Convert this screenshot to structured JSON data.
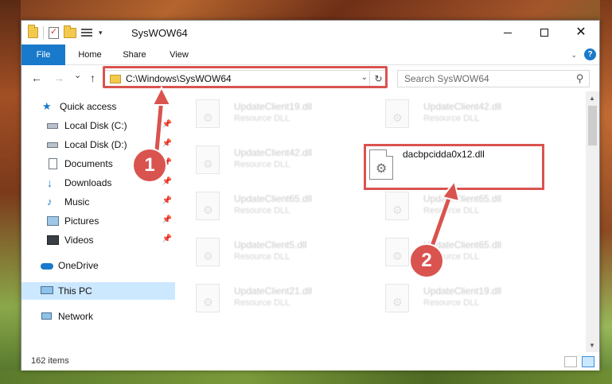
{
  "window": {
    "title": "SysWOW64"
  },
  "ribbon": {
    "tabs": [
      "File",
      "Home",
      "Share",
      "View"
    ],
    "help": "?"
  },
  "navigation": {
    "back": "←",
    "forward": "→",
    "recent": "⌄",
    "up": "↑",
    "address": "C:\\Windows\\SysWOW64",
    "search_placeholder": "Search SysWOW64"
  },
  "sidebar": {
    "items": [
      {
        "label": "Quick access",
        "icon": "star-icon",
        "pinned": false
      },
      {
        "label": "Local Disk (C:)",
        "icon": "drive-icon",
        "pinned": true
      },
      {
        "label": "Local Disk (D:)",
        "icon": "drive-icon",
        "pinned": true
      },
      {
        "label": "Documents",
        "icon": "documents-icon",
        "pinned": true
      },
      {
        "label": "Downloads",
        "icon": "downloads-icon",
        "pinned": true
      },
      {
        "label": "Music",
        "icon": "music-icon",
        "pinned": true
      },
      {
        "label": "Pictures",
        "icon": "pictures-icon",
        "pinned": true
      },
      {
        "label": "Videos",
        "icon": "videos-icon",
        "pinned": true
      },
      {
        "label": "OneDrive",
        "icon": "onedrive-icon",
        "pinned": false
      },
      {
        "label": "This PC",
        "icon": "this-pc-icon",
        "pinned": false,
        "selected": true
      },
      {
        "label": "Network",
        "icon": "network-icon",
        "pinned": false
      }
    ]
  },
  "files": {
    "left_column": [
      {
        "name": "UpdateClient19.dll",
        "type": "Resource DLL"
      },
      {
        "name": "UpdateClient42.dll",
        "type": "Resource DLL"
      },
      {
        "name": "UpdateClient65.dll",
        "type": "Resource DLL"
      },
      {
        "name": "UpdateClient5.dll",
        "type": "Resource DLL"
      },
      {
        "name": "UpdateClient21.dll",
        "type": "Resource DLL"
      }
    ],
    "right_column": [
      {
        "name": "UpdateClient42.dll",
        "type": "Resource DLL"
      },
      {
        "name": "UpdateClient65.dll",
        "type": "Resource DLL"
      },
      {
        "name": "UpdateClient65.dll",
        "type": "Resource DLL"
      },
      {
        "name": "UpdateClient19.dll",
        "type": "Resource DLL"
      }
    ],
    "highlighted": {
      "name": "dacbpcidda0x12.dll"
    }
  },
  "status": {
    "item_count": "162 items"
  },
  "callouts": {
    "step1": "1",
    "step2": "2",
    "color": "#d9534f"
  }
}
